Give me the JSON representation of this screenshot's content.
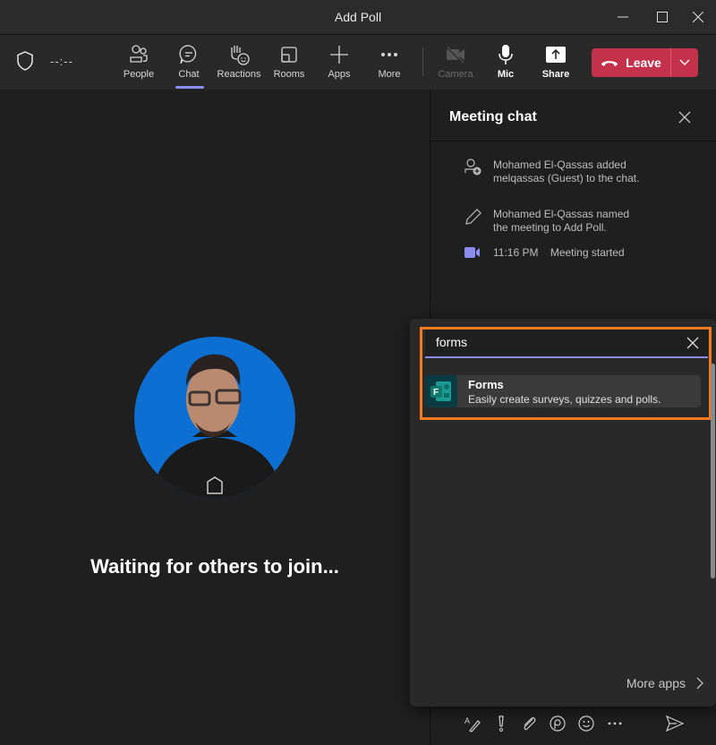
{
  "window": {
    "title": "Add Poll"
  },
  "toolbar": {
    "timer": "--:--",
    "items": [
      {
        "label": "People"
      },
      {
        "label": "Chat"
      },
      {
        "label": "Reactions"
      },
      {
        "label": "Rooms"
      },
      {
        "label": "Apps"
      },
      {
        "label": "More"
      },
      {
        "label": "Camera"
      },
      {
        "label": "Mic"
      },
      {
        "label": "Share"
      }
    ],
    "leave_label": "Leave",
    "leave_color": "#c4314b",
    "active_accent": "#8b8cf0"
  },
  "stage": {
    "waiting_text": "Waiting for others to join..."
  },
  "chat": {
    "title": "Meeting chat",
    "events": [
      {
        "icon": "person-add-icon",
        "text": "Mohamed El-Qassas added melqassas (Guest) to the chat."
      },
      {
        "icon": "pencil-icon",
        "text": "Mohamed El-Qassas named the meeting to Add Poll."
      },
      {
        "icon": "video-icon",
        "time": "11:16 PM",
        "text": "Meeting started"
      }
    ]
  },
  "apps_popup": {
    "search_value": "forms",
    "results": [
      {
        "name": "Forms",
        "description": "Easily create surveys, quizzes and polls."
      }
    ],
    "more_apps_label": "More apps",
    "highlight_color": "#f5791e"
  }
}
